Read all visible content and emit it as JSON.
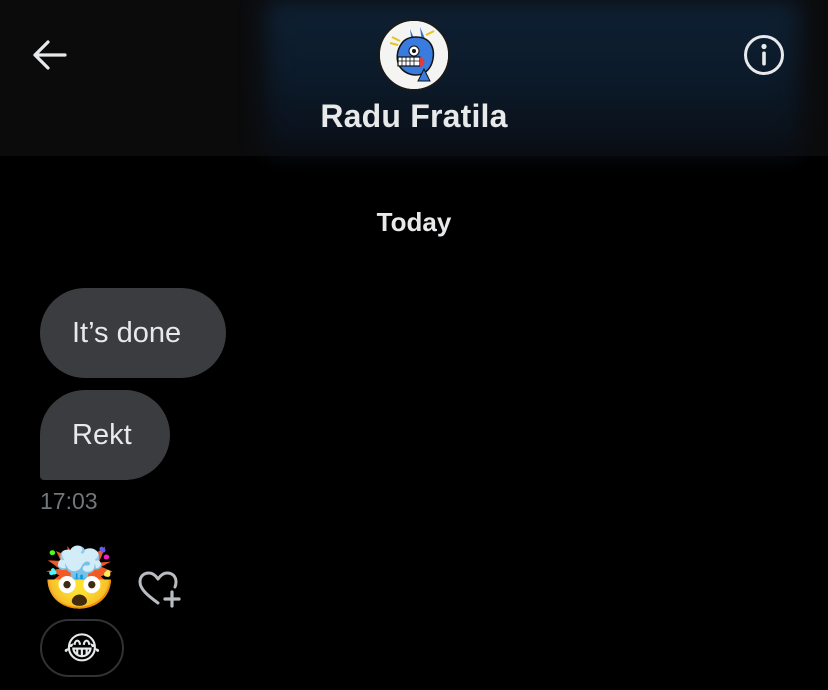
{
  "header": {
    "contact_name": "Radu Fratila",
    "back_icon": "arrow-left-icon",
    "info_icon": "info-circle-icon",
    "avatar_icon": "cartoon-avatar-icon"
  },
  "conversation": {
    "day_label": "Today",
    "messages": [
      {
        "text": "It’s done"
      },
      {
        "text": "Rekt"
      }
    ],
    "timestamp": "17:03",
    "reactions": {
      "primary_emoji": "🤯",
      "add_reaction_icon": "heart-plus-icon",
      "pill_emoji": "😂"
    }
  },
  "colors": {
    "background": "#000000",
    "bubble": "#3b3c3f",
    "text": "#e7e9ea",
    "muted": "#71767b"
  }
}
